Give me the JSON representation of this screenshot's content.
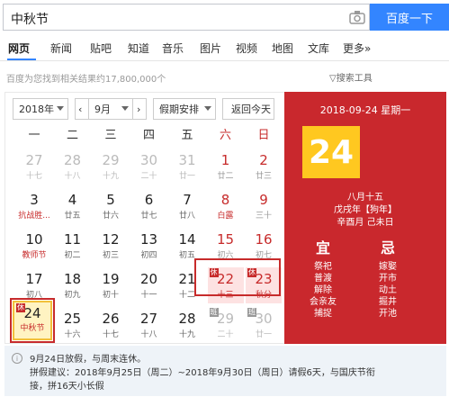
{
  "search": {
    "query": "中秋节",
    "button": "百度一下",
    "camera_icon": "camera-icon"
  },
  "tabs": [
    {
      "label": "网页"
    },
    {
      "label": "新闻"
    },
    {
      "label": "贴吧"
    },
    {
      "label": "知道"
    },
    {
      "label": "音乐"
    },
    {
      "label": "图片"
    },
    {
      "label": "视频"
    },
    {
      "label": "地图"
    },
    {
      "label": "文库"
    },
    {
      "label": "更多»"
    }
  ],
  "result_count": "百度为您找到相关结果约17,800,000个",
  "search_tools": "搜索工具",
  "calendar": {
    "year_select": "2018年",
    "month_select": "9月",
    "holiday_select": "假期安排",
    "today_button": "返回今天",
    "weekdays": [
      "一",
      "二",
      "三",
      "四",
      "五",
      "六",
      "日"
    ],
    "weeks": [
      [
        {
          "d": "27",
          "l": "十七",
          "t": "ghost"
        },
        {
          "d": "28",
          "l": "十八",
          "t": "ghost"
        },
        {
          "d": "29",
          "l": "十九",
          "t": "ghost"
        },
        {
          "d": "30",
          "l": "二十",
          "t": "ghost"
        },
        {
          "d": "31",
          "l": "廿一",
          "t": "ghost"
        },
        {
          "d": "1",
          "l": "廿二",
          "t": "wkend"
        },
        {
          "d": "2",
          "l": "廿三",
          "t": "wkend"
        }
      ],
      [
        {
          "d": "3",
          "l": "抗战胜...",
          "t": "fest"
        },
        {
          "d": "4",
          "l": "廿五",
          "t": "norm"
        },
        {
          "d": "5",
          "l": "廿六",
          "t": "norm"
        },
        {
          "d": "6",
          "l": "廿七",
          "t": "norm"
        },
        {
          "d": "7",
          "l": "廿八",
          "t": "norm"
        },
        {
          "d": "8",
          "l": "白露",
          "t": "wkend fest"
        },
        {
          "d": "9",
          "l": "三十",
          "t": "wkend"
        }
      ],
      [
        {
          "d": "10",
          "l": "教师节",
          "t": "fest"
        },
        {
          "d": "11",
          "l": "初二",
          "t": "norm"
        },
        {
          "d": "12",
          "l": "初三",
          "t": "norm"
        },
        {
          "d": "13",
          "l": "初四",
          "t": "norm"
        },
        {
          "d": "14",
          "l": "初五",
          "t": "norm"
        },
        {
          "d": "15",
          "l": "初六",
          "t": "wkend"
        },
        {
          "d": "16",
          "l": "初七",
          "t": "wkend"
        }
      ],
      [
        {
          "d": "17",
          "l": "初八",
          "t": "norm"
        },
        {
          "d": "18",
          "l": "初九",
          "t": "norm"
        },
        {
          "d": "19",
          "l": "初十",
          "t": "norm"
        },
        {
          "d": "20",
          "l": "十一",
          "t": "norm"
        },
        {
          "d": "21",
          "l": "十二",
          "t": "norm"
        },
        {
          "d": "22",
          "l": "十三",
          "t": "hl",
          "b": "休"
        },
        {
          "d": "23",
          "l": "秋分",
          "t": "hl",
          "b": "休"
        }
      ],
      [
        {
          "d": "24",
          "l": "中秋节",
          "t": "today",
          "b": "休"
        },
        {
          "d": "25",
          "l": "十六",
          "t": "norm"
        },
        {
          "d": "26",
          "l": "十七",
          "t": "norm"
        },
        {
          "d": "27",
          "l": "十八",
          "t": "norm"
        },
        {
          "d": "28",
          "l": "十九",
          "t": "norm"
        },
        {
          "d": "29",
          "l": "二十",
          "t": "ghost",
          "b": "班"
        },
        {
          "d": "30",
          "l": "廿一",
          "t": "ghost",
          "b": "班"
        }
      ]
    ]
  },
  "panel": {
    "date": "2018-09-24 星期一",
    "day": "24",
    "lunar": "八月十五",
    "ganzhi_year": "戊戌年【狗年】",
    "ganzhi_md": "辛酉月 己未日",
    "yi_title": "宜",
    "ji_title": "忌",
    "yi": [
      "祭祀",
      "普渡",
      "解除",
      "会亲友",
      "捕捉"
    ],
    "ji": [
      "嫁娶",
      "开市",
      "动土",
      "掘井",
      "开池"
    ]
  },
  "info": {
    "line1": "9月24日放假，与周末连休。",
    "line2": "拼假建议：2018年9月25日（周二）~2018年9月30日（周日）请假6天，与国庆节衔",
    "line3": "接，拼16天小长假"
  },
  "colors": {
    "accent": "#3385ff",
    "holiday_red": "#c9282d",
    "today_yellow": "#ffc820"
  }
}
